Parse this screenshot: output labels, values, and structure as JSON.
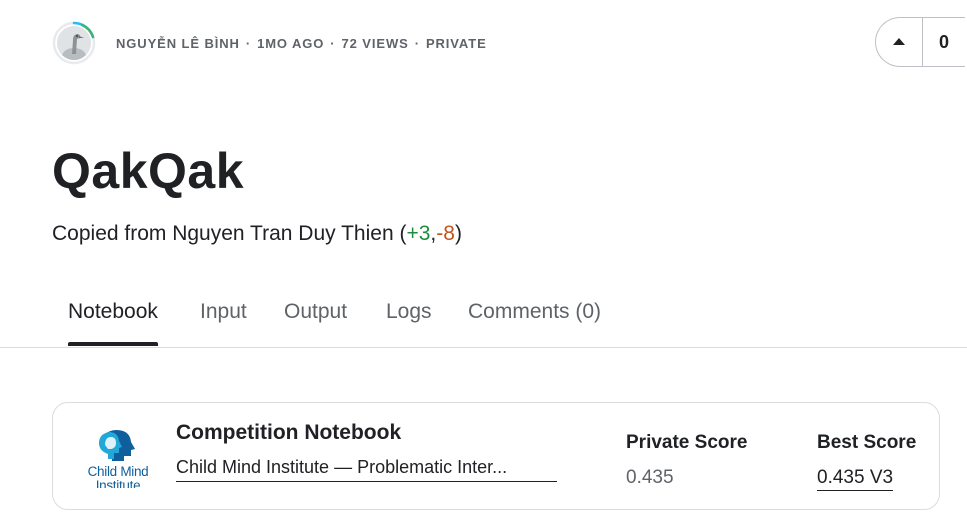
{
  "header": {
    "author": "NGUYỄN LÊ BÌNH",
    "age": "1MO AGO",
    "views": "72 VIEWS",
    "visibility": "PRIVATE",
    "separator": "·"
  },
  "vote": {
    "count": "0",
    "icon": "caret-up-icon"
  },
  "notebook": {
    "title": "QakQak",
    "copied_prefix": "Copied from Nguyen Tran Duy Thien (",
    "plus": "+3",
    "comma": ",",
    "minus": "-8",
    "suffix": ")"
  },
  "tabs": [
    {
      "label": "Notebook",
      "active": true
    },
    {
      "label": "Input"
    },
    {
      "label": "Output"
    },
    {
      "label": "Logs"
    },
    {
      "label": "Comments (0)"
    }
  ],
  "card": {
    "heading": "Competition Notebook",
    "competition": "Child Mind Institute — Problematic Inter...",
    "logo_text_1": "Child Mind",
    "logo_text_2": "Institute",
    "private_score_label": "Private Score",
    "private_score": "0.435",
    "best_score_label": "Best Score",
    "best_score": "0.435 V3"
  },
  "colors": {
    "accent_green": "#1e8e3e",
    "accent_orange": "#c5531b",
    "logo_blue": "#0f5f9c",
    "logo_cyan": "#21a7d8"
  }
}
